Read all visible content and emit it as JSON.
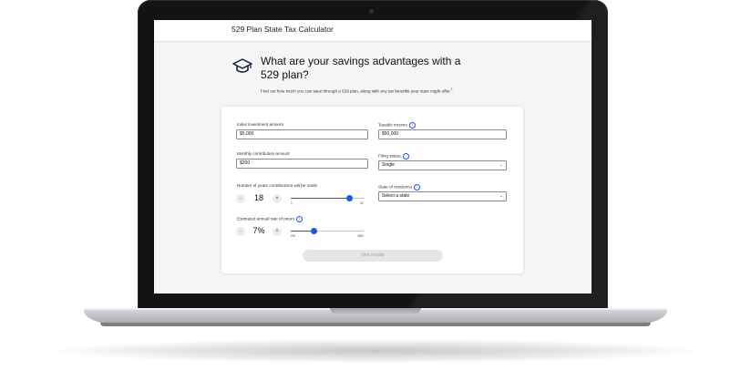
{
  "app": {
    "title": "529 Plan State Tax Calculator",
    "heading": "What are your savings advantages with a 529 plan?",
    "subheading": "Find out how much you can save through a 529 plan, along with any tax benefits your state might offer.",
    "subheading_note": "1"
  },
  "form": {
    "initial_investment": {
      "label": "Initial investment amount",
      "value": "$5,000"
    },
    "monthly_contribution": {
      "label": "Monthly contribution amount",
      "value": "$200"
    },
    "years": {
      "label": "Number of years contributions will be made",
      "value": "18",
      "minus": "-",
      "plus": "+",
      "min_label": "1",
      "max_label": "22",
      "min": 1,
      "max": 22,
      "level": 18
    },
    "return_rate": {
      "label": "Estimated annual rate of return",
      "value": "7%",
      "minus": "-",
      "plus": "+",
      "min_label": "2%",
      "max_label": "18%",
      "min": 2,
      "max": 18,
      "level": 7
    },
    "taxable_income": {
      "label": "Taxable income",
      "value": "$50,000"
    },
    "filing_status": {
      "label": "Filing status",
      "value": "Single"
    },
    "state": {
      "label": "State of residence",
      "value": "Select a state"
    },
    "info_glyph": "i",
    "caret_glyph": "⌄",
    "submit_label": "See results"
  },
  "colors": {
    "accent": "#1a5bd6",
    "screen_bg": "#f5f5f5",
    "bezel": "#121314"
  },
  "icons": {
    "hero": "graduation-cap-icon"
  }
}
